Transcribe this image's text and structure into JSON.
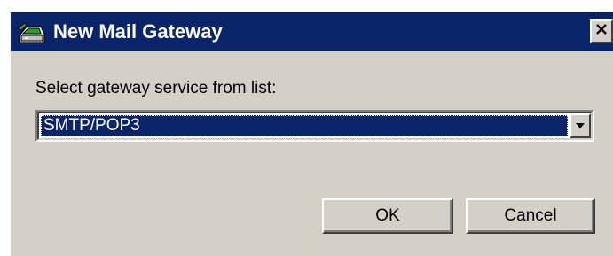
{
  "dialog": {
    "title": "New Mail Gateway",
    "title_icon": "mail-gateway-icon",
    "close_icon": "close-icon"
  },
  "form": {
    "label": "Select gateway service from list:",
    "select": {
      "value": "SMTP/POP3",
      "arrow_icon": "chevron-down-icon"
    }
  },
  "buttons": {
    "ok_label": "OK",
    "cancel_label": "Cancel"
  },
  "colors": {
    "titlebar": "#0a246a",
    "face": "#d4d0c8",
    "selection": "#0a246a"
  }
}
